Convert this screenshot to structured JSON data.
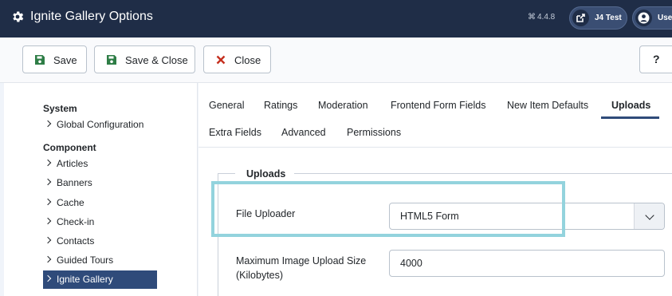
{
  "header": {
    "title": "Ignite Gallery Options",
    "version": "4.4.8",
    "site_button": "J4 Test",
    "user_button": "User"
  },
  "toolbar": {
    "save_label": "Save",
    "save_close_label": "Save & Close",
    "close_label": "Close",
    "help_label": "?"
  },
  "sidebar": {
    "system_heading": "System",
    "system_items": [
      {
        "label": "Global Configuration"
      }
    ],
    "component_heading": "Component",
    "component_items": [
      {
        "label": "Articles"
      },
      {
        "label": "Banners"
      },
      {
        "label": "Cache"
      },
      {
        "label": "Check-in"
      },
      {
        "label": "Contacts"
      },
      {
        "label": "Guided Tours"
      },
      {
        "label": "Ignite Gallery"
      }
    ]
  },
  "tabs": [
    {
      "label": "General"
    },
    {
      "label": "Ratings"
    },
    {
      "label": "Moderation"
    },
    {
      "label": "Frontend Form Fields"
    },
    {
      "label": "New Item Defaults"
    },
    {
      "label": "Uploads"
    },
    {
      "label": "Extra Fields"
    },
    {
      "label": "Advanced"
    },
    {
      "label": "Permissions"
    }
  ],
  "uploads": {
    "legend": "Uploads",
    "file_uploader_label": "File Uploader",
    "file_uploader_value": "HTML5 Form",
    "max_size_label_line1": "Maximum Image Upload Size",
    "max_size_label_line2": "(Kilobytes)",
    "max_size_value": "4000"
  },
  "colors": {
    "header_bg": "#1f2d47",
    "active_nav": "#2f4b7a",
    "save_icon": "#2e7d46",
    "close_icon": "#c5301f",
    "highlight": "#93d3dd"
  },
  "icons": {
    "header": "gear-icon",
    "save": "floppy-disk-icon",
    "close": "x-icon",
    "site": "external-link-icon",
    "user": "user-circle-icon"
  }
}
